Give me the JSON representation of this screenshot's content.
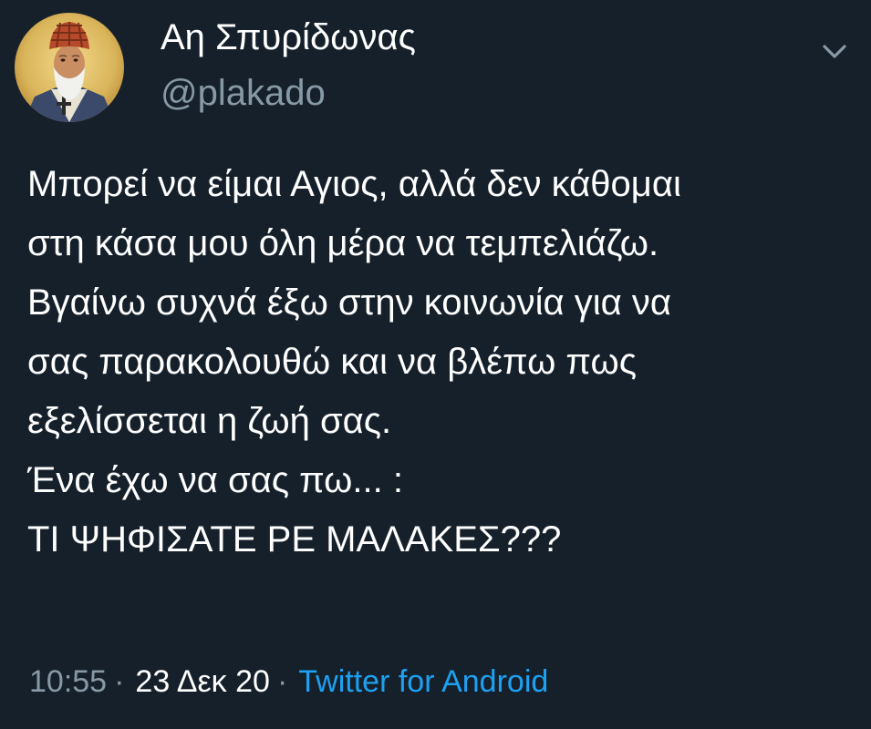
{
  "tweet": {
    "author": {
      "display_name": "Αη Σπυρίδωνας",
      "handle": "@plakado",
      "avatar": "saint-icon-avatar"
    },
    "menu_icon": "chevron-down-icon",
    "text_lines": [
      "Μπορεί να είμαι Αγιος, αλλά δεν κάθομαι",
      "στη κάσα μου όλη μέρα να τεμπελιάζω.",
      "Βγαίνω συχνά έξω στην κοινωνία για να",
      "σας παρακολουθώ και να βλέπω πως",
      "εξελίσσεται η ζωή σας.",
      "Ένα έχω να σας πω... :",
      "ΤΙ ΨΗΦΙΣΑΤΕ ΡΕ ΜΑΛΑΚΕΣ???"
    ],
    "meta": {
      "time": "10:55",
      "separator": "·",
      "date": "23 Δεκ 20",
      "source": "Twitter for Android"
    }
  },
  "colors": {
    "background": "#15202b",
    "text_primary": "#ffffff",
    "text_secondary": "#8899a6",
    "link": "#1da1f2"
  }
}
